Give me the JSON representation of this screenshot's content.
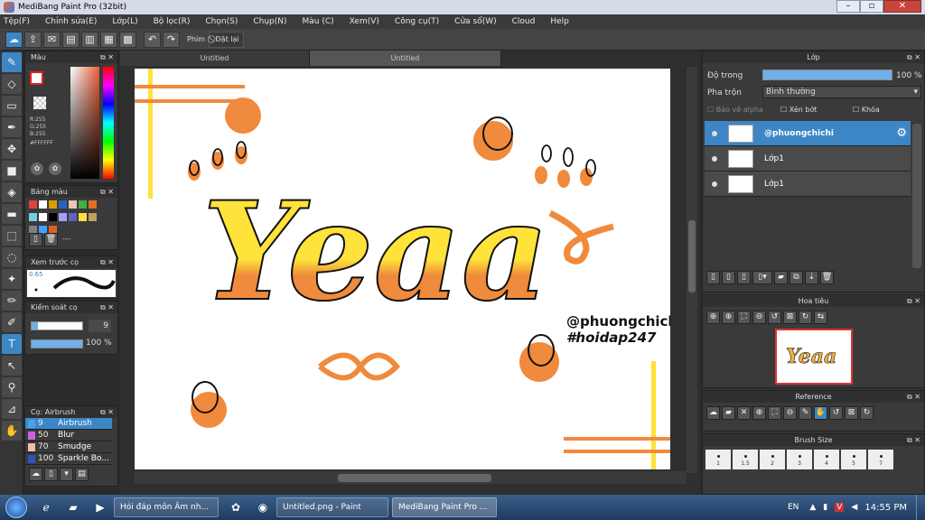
{
  "window": {
    "title": "MediBang Paint Pro (32bit)",
    "min": "–",
    "max": "▫",
    "close": "✕"
  },
  "menu": [
    "Tệp(F)",
    "Chỉnh sửa(E)",
    "Lớp(L)",
    "Bộ lọc(R)",
    "Chọn(S)",
    "Chụp(N)",
    "Màu (C)",
    "Xem(V)",
    "Công cụ(T)",
    "Cửa sổ(W)",
    "Cloud",
    "Help"
  ],
  "toolbar": {
    "phim_label": "Phím",
    "reset_label": "Đặt lại"
  },
  "doc_tabs": [
    "Untitled",
    "Untitled"
  ],
  "color_panel": {
    "title": "Màu",
    "r": "R:255",
    "g": "G:255",
    "b": "B:255",
    "hex": "#FFFFFF"
  },
  "palette_panel": {
    "title": "Bảng màu",
    "more": "---",
    "swatches": [
      "#e04040",
      "#ffffff",
      "#d4a000",
      "#2a60c0",
      "#e9c7b0",
      "#40b040",
      "#e07020",
      "#70d0e0",
      "#ffffff",
      "#000000",
      "#a0a0ff",
      "#6060c0",
      "#ffe040",
      "#c0a060",
      "#808080",
      "#40a0ff",
      "#e06020"
    ]
  },
  "brush_preview": {
    "title": "Xem trước cọ",
    "size": "0.65"
  },
  "brush_control": {
    "title": "Kiểm soát cọ",
    "size": "9",
    "opacity": "100 %"
  },
  "brush_list": {
    "title": "Cọ: Airbrush",
    "items": [
      {
        "size": "9",
        "name": "Airbrush",
        "color": "#4aa0e8"
      },
      {
        "size": "50",
        "name": "Blur",
        "color": "#d060e0"
      },
      {
        "size": "70",
        "name": "Smudge",
        "color": "#f0c0a0"
      },
      {
        "size": "100",
        "name": "Sparkle Bo...",
        "color": "#3050c0"
      }
    ]
  },
  "canvas_text": {
    "main": "Yeaa",
    "handle": "@phuongchichi",
    "tag": "#hoidap247"
  },
  "layer_panel": {
    "title": "Lớp",
    "opacity_label": "Độ trong",
    "opacity_value": "100 %",
    "blend_label": "Pha trộn",
    "blend_value": "Bình thường",
    "alpha_label": "Bảo vệ alpha",
    "clip_label": "Xén bớt",
    "lock_label": "Khóa",
    "layers": [
      "@phuongchichi",
      "Lớp1",
      "Lớp1"
    ]
  },
  "navigator": {
    "title": "Hoa tiêu"
  },
  "reference": {
    "title": "Reference"
  },
  "brush_size": {
    "title": "Brush Size",
    "sizes": [
      "1",
      "1.5",
      "2",
      "3",
      "4",
      "5",
      "7"
    ]
  },
  "taskbar": {
    "items": [
      "Hỏi đáp môn Âm nh...",
      "Untitled.png - Paint",
      "MediBang Paint Pro ..."
    ],
    "lang": "EN",
    "time": "14:55 PM"
  }
}
